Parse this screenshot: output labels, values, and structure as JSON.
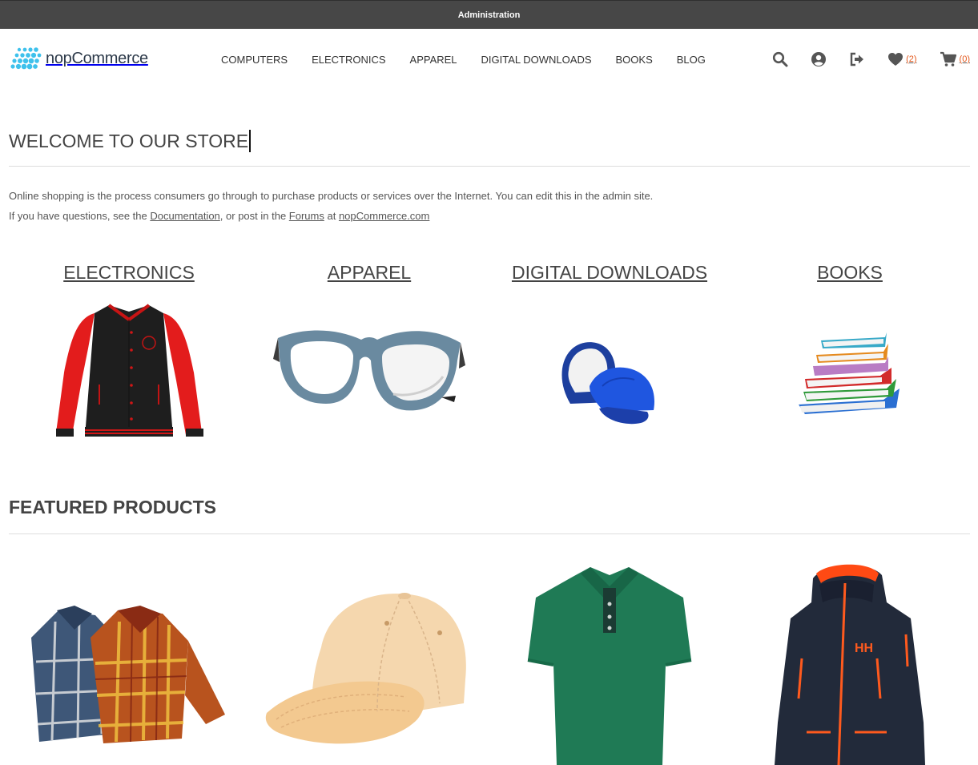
{
  "admin_bar": {
    "label": "Administration"
  },
  "logo": {
    "text": "nopCommerce",
    "color": "#3ec1ec"
  },
  "menu": [
    {
      "label": "COMPUTERS"
    },
    {
      "label": "ELECTRONICS"
    },
    {
      "label": "APPAREL"
    },
    {
      "label": "DIGITAL DOWNLOADS"
    },
    {
      "label": "BOOKS"
    },
    {
      "label": "BLOG"
    }
  ],
  "header_links": {
    "wishlist_count": "(2)",
    "cart_count": "(0)",
    "icons": [
      "search-icon",
      "account-icon",
      "logout-icon",
      "heart-icon",
      "cart-icon"
    ]
  },
  "welcome": {
    "title": "WELCOME TO OUR STORE",
    "line1": "Online shopping is the process consumers go through to purchase products or services over the Internet. You can edit this in the admin site.",
    "line2_prefix": "If you have questions, see the ",
    "link_documentation": "Documentation",
    "line2_mid": ", or post in the ",
    "link_forums": "Forums",
    "line2_at": " at ",
    "link_site": "nopCommerce.com"
  },
  "categories": [
    {
      "title": "ELECTRONICS",
      "image": "varsity-jacket"
    },
    {
      "title": "APPAREL",
      "image": "eyeglasses"
    },
    {
      "title": "DIGITAL DOWNLOADS",
      "image": "baseball-caps"
    },
    {
      "title": "BOOKS",
      "image": "book-stack"
    }
  ],
  "featured": {
    "title": "FEATURED PRODUCTS",
    "products": [
      {
        "image": "plaid-shirts"
      },
      {
        "image": "baseball-cap"
      },
      {
        "image": "green-polo-shirt"
      },
      {
        "image": "rain-jacket"
      }
    ]
  },
  "colors": {
    "accent": "#e4571b",
    "admin_bar": "#474747",
    "text": "#444444"
  }
}
